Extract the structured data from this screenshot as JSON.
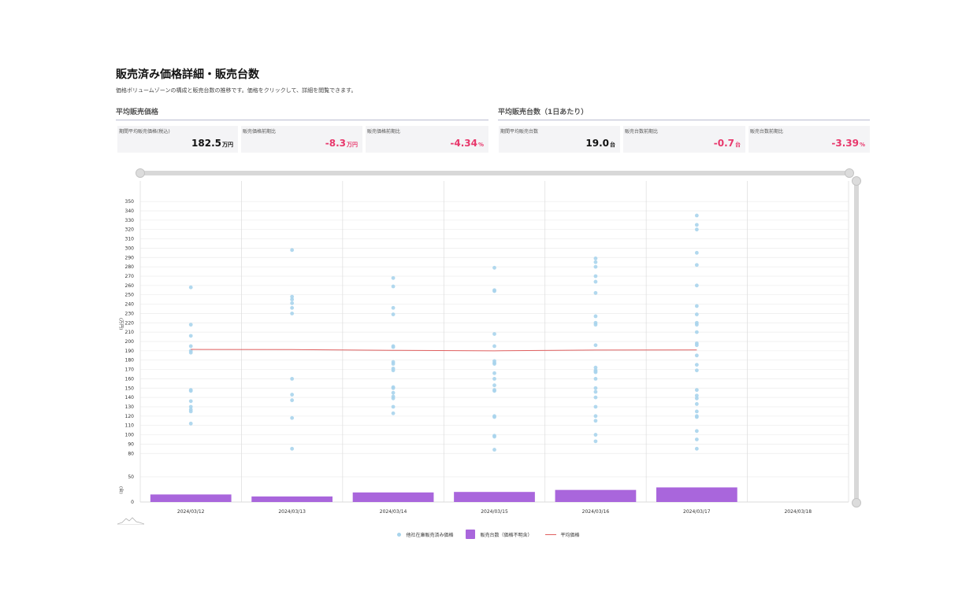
{
  "header": {
    "title": "販売済み価格詳細・販売台数",
    "description": "価格ボリュームゾーンの構成と販売台数の推移です。価格をクリックして、詳細を閲覧できます。"
  },
  "sections": {
    "left_title": "平均販売価格",
    "right_title": "平均販売台数（1日あたり）"
  },
  "kpis": [
    {
      "label": "期間平均販売価格(税込)",
      "value": "182.5",
      "unit": "万円",
      "tone": "pos"
    },
    {
      "label": "販売価格前期比",
      "value": "-8.3",
      "unit": "万円",
      "tone": "neg"
    },
    {
      "label": "販売価格前期比",
      "value": "-4.34",
      "unit": "%",
      "tone": "neg"
    },
    {
      "label": "期間平均販売台数",
      "value": "19.0",
      "unit": "台",
      "tone": "pos"
    },
    {
      "label": "販売台数前期比",
      "value": "-0.7",
      "unit": "台",
      "tone": "neg"
    },
    {
      "label": "販売台数前期比",
      "value": "-3.39",
      "unit": "%",
      "tone": "neg"
    }
  ],
  "colors": {
    "scatter": "#a8d4ec",
    "bar": "#a966dc",
    "avg_line": "#e06060",
    "negative": "#e8386c"
  },
  "chart_data": {
    "type": "scatter",
    "categories": [
      "2024/03/12",
      "2024/03/13",
      "2024/03/14",
      "2024/03/15",
      "2024/03/16",
      "2024/03/17",
      "2024/03/18"
    ],
    "price_axis": {
      "label": "(万円)",
      "ticks": [
        80,
        90,
        100,
        110,
        120,
        130,
        140,
        150,
        160,
        170,
        180,
        190,
        200,
        210,
        220,
        230,
        240,
        250,
        260,
        270,
        280,
        290,
        300,
        310,
        320,
        330,
        340,
        350
      ],
      "ylim": [
        76,
        356
      ]
    },
    "count_axis": {
      "label": "(台)",
      "ticks": [
        0,
        50
      ],
      "ylim": [
        0,
        50
      ]
    },
    "series": [
      {
        "name": "他社在庫販売済み価格",
        "kind": "scatter",
        "values": [
          [
            258,
            218,
            206,
            195,
            190,
            188,
            148,
            147,
            136,
            130,
            127,
            125,
            112
          ],
          [
            298,
            248,
            245,
            241,
            236,
            230,
            160,
            143,
            137,
            118,
            85
          ],
          [
            268,
            259,
            236,
            229,
            195,
            194,
            178,
            176,
            171,
            169,
            151,
            150,
            145,
            141,
            139,
            130,
            123
          ],
          [
            279,
            255,
            254,
            208,
            195,
            179,
            177,
            176,
            166,
            160,
            153,
            148,
            147,
            120,
            119,
            99,
            98,
            84
          ],
          [
            289,
            285,
            280,
            270,
            264,
            252,
            227,
            220,
            218,
            196,
            172,
            169,
            168,
            167,
            160,
            150,
            146,
            140,
            130,
            120,
            115,
            100,
            93
          ],
          [
            335,
            325,
            320,
            295,
            282,
            260,
            238,
            229,
            220,
            218,
            210,
            198,
            196,
            185,
            175,
            169,
            148,
            142,
            139,
            133,
            125,
            120,
            119,
            104,
            95,
            85
          ],
          []
        ]
      },
      {
        "name": "販売台数（価格不明含）",
        "kind": "bar",
        "values": [
          15,
          11,
          19,
          20,
          24,
          29,
          0
        ]
      },
      {
        "name": "平均価格",
        "kind": "line",
        "values": [
          191.5,
          191.3,
          190.5,
          190.0,
          190.8,
          190.9
        ]
      }
    ]
  }
}
